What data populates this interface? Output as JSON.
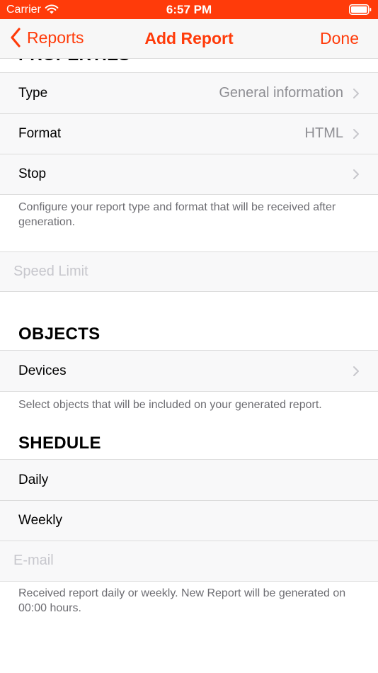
{
  "status_bar": {
    "carrier": "Carrier",
    "time": "6:57 PM"
  },
  "nav": {
    "back_label": "Reports",
    "title": "Add Report",
    "done_label": "Done"
  },
  "properties": {
    "header": "PROPERTIES",
    "rows": [
      {
        "label": "Type",
        "value": "General information"
      },
      {
        "label": "Format",
        "value": "HTML"
      },
      {
        "label": "Stop",
        "value": ""
      }
    ],
    "footer": "Configure your report type and format that will be received after generation.",
    "speed_limit_placeholder": "Speed Limit"
  },
  "objects": {
    "header": "OBJECTS",
    "rows": [
      {
        "label": "Devices"
      }
    ],
    "footer": "Select objects that will be included on your generated report."
  },
  "schedule": {
    "header": "SHEDULE",
    "rows": [
      {
        "label": "Daily"
      },
      {
        "label": "Weekly"
      }
    ],
    "email_placeholder": "E-mail",
    "footer": "Received report daily or weekly. New Report will be generated on 00:00 hours."
  },
  "colors": {
    "accent": "#ff3b0a",
    "secondary_text": "#8e8e93",
    "placeholder": "#c7c7cd"
  }
}
